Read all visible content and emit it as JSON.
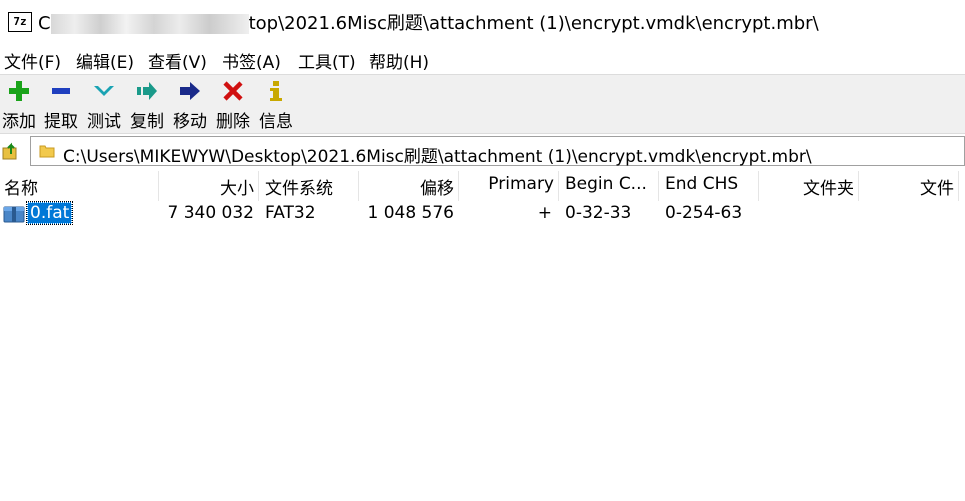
{
  "title": {
    "app_icon": "7z",
    "prefix": "C",
    "suffix": "top\\2021.6Misc刷题\\attachment (1)\\encrypt.vmdk\\encrypt.mbr\\"
  },
  "menu": [
    {
      "label": "文件(F)"
    },
    {
      "label": "编辑(E)"
    },
    {
      "label": "查看(V)"
    },
    {
      "label": "书签(A)"
    },
    {
      "label": "工具(T)"
    },
    {
      "label": "帮助(H)"
    }
  ],
  "toolbar": [
    {
      "label": "添加",
      "icon": "plus-icon",
      "color": "#1aa31a"
    },
    {
      "label": "提取",
      "icon": "minus-icon",
      "color": "#1f3fbf"
    },
    {
      "label": "测试",
      "icon": "check-icon",
      "color": "#1aa3b3"
    },
    {
      "label": "复制",
      "icon": "copy-arrow-icon",
      "color": "#1a9a8a"
    },
    {
      "label": "移动",
      "icon": "move-arrow-icon",
      "color": "#1a2a8a"
    },
    {
      "label": "删除",
      "icon": "delete-x-icon",
      "color": "#d01010"
    },
    {
      "label": "信息",
      "icon": "info-icon",
      "color": "#c8a800"
    }
  ],
  "address": {
    "path": "C:\\Users\\MIKEWYW\\Desktop\\2021.6Misc刷题\\attachment (1)\\encrypt.vmdk\\encrypt.mbr\\"
  },
  "columns": [
    "名称",
    "大小",
    "文件系统",
    "偏移",
    "Primary",
    "Begin C...",
    "End CHS",
    "文件夹",
    "文件"
  ],
  "rows": [
    {
      "name": "0.fat",
      "size": "7 340 032",
      "fs": "FAT32",
      "offset": "1 048 576",
      "primary": "+",
      "begin_chs": "0-32-33",
      "end_chs": "0-254-63",
      "folders": "",
      "files": ""
    }
  ]
}
